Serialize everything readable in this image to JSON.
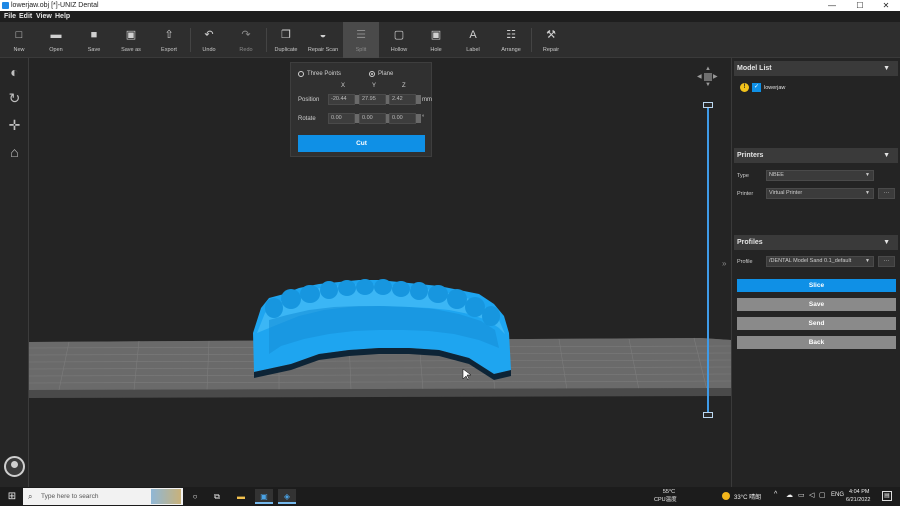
{
  "window": {
    "title": "lowerjaw.obj [*]-UNIZ Dental",
    "min_glyph": "—",
    "max_glyph": "☐",
    "close_glyph": "✕"
  },
  "menu": [
    "File",
    "Edit",
    "View",
    "Help"
  ],
  "toolbar": [
    {
      "label": "New",
      "icon": "new-icon",
      "glyph": "□"
    },
    {
      "label": "Open",
      "icon": "open-icon",
      "glyph": "▬"
    },
    {
      "label": "Save",
      "icon": "save-icon",
      "glyph": "■"
    },
    {
      "label": "Save as",
      "icon": "save-as-icon",
      "glyph": "▣"
    },
    {
      "label": "Export",
      "icon": "export-icon",
      "glyph": "⇧"
    },
    {
      "label": "Undo",
      "icon": "undo-icon",
      "glyph": "↶"
    },
    {
      "label": "Redo",
      "icon": "redo-icon",
      "glyph": "↷"
    },
    {
      "label": "Duplicate",
      "icon": "duplicate-icon",
      "glyph": "❐"
    },
    {
      "label": "Repair Scan",
      "icon": "repair-scan-icon",
      "glyph": "◒"
    },
    {
      "label": "Split",
      "icon": "split-icon",
      "glyph": "☰"
    },
    {
      "label": "Hollow",
      "icon": "hollow-icon",
      "glyph": "▢"
    },
    {
      "label": "Hole",
      "icon": "hole-icon",
      "glyph": "▣"
    },
    {
      "label": "Label",
      "icon": "label-icon",
      "glyph": "A"
    },
    {
      "label": "Arrange",
      "icon": "arrange-icon",
      "glyph": "☷"
    },
    {
      "label": "Repair",
      "icon": "wrench-icon",
      "glyph": "⚒"
    }
  ],
  "left_tools": [
    {
      "icon": "move-view-icon",
      "glyph": "◐"
    },
    {
      "icon": "rotate-icon",
      "glyph": "↻"
    },
    {
      "icon": "translate-icon",
      "glyph": "✛"
    },
    {
      "icon": "support-icon",
      "glyph": "⌂"
    }
  ],
  "cut_panel": {
    "mode_three_points": "Three Points",
    "mode_plane": "Plane",
    "selected_mode": "Plane",
    "axis_x": "X",
    "axis_y": "Y",
    "axis_z": "Z",
    "position_label": "Position",
    "position": [
      "-20.44",
      "27.95",
      "2.42"
    ],
    "position_unit": "mm",
    "rotate_label": "Rotate",
    "rotate": [
      "0.00",
      "0.00",
      "0.00"
    ],
    "rotate_unit": "°",
    "cut_button": "Cut"
  },
  "model_list": {
    "title": "Model List",
    "items": [
      {
        "name": "lowerjaw",
        "checked": true,
        "warning": true
      }
    ]
  },
  "printers": {
    "title": "Printers",
    "type_label": "Type",
    "type_value": "NBEE",
    "printer_label": "Printer",
    "printer_value": "Virtual Printer",
    "more": "···"
  },
  "profiles": {
    "title": "Profiles",
    "profile_label": "Profile",
    "profile_value": "/DENTAL Model Sand 0.1_default",
    "more": "···",
    "collapse_glyph": "»"
  },
  "actions": [
    {
      "label": "Slice",
      "color": "#0f90e6"
    },
    {
      "label": "Save",
      "color": "#8a8a8a"
    },
    {
      "label": "Send",
      "color": "#8a8a8a"
    },
    {
      "label": "Back",
      "color": "#8a8a8a"
    }
  ],
  "taskbar": {
    "start_glyph": "⊞",
    "search_placeholder": "Type here to search",
    "temp_cpu": "55°C",
    "cpu_label": "CPU温度",
    "weather": "33°C 晴朗",
    "lang": "ENG",
    "time": "4:04 PM",
    "date": "6/21/2022"
  },
  "colors": {
    "accent": "#0f90e6",
    "model": "#1ea5f0",
    "slider": "#3f9be8"
  }
}
